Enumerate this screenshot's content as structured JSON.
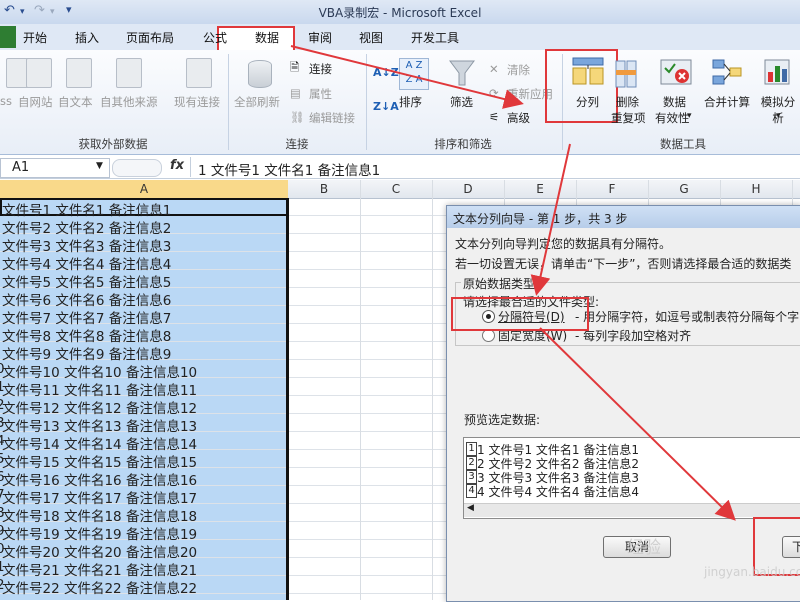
{
  "window": {
    "title": "VBA录制宏 - Microsoft Excel"
  },
  "quick_access": {
    "undo_icon": "undo-icon",
    "redo_icon": "redo-icon",
    "customize": "▾"
  },
  "tabs": [
    "开始",
    "插入",
    "页面布局",
    "公式",
    "数据",
    "审阅",
    "视图",
    "开发工具"
  ],
  "active_tab": "数据",
  "ribbon": {
    "external": {
      "label": "获取外部数据",
      "buttons": [
        "ss",
        "自网站",
        "自文本",
        "自其他来源",
        "现有连接"
      ]
    },
    "connections": {
      "label": "连接",
      "refresh": "全部刷新",
      "items": [
        "连接",
        "属性",
        "编辑链接"
      ]
    },
    "sortfilter": {
      "label": "排序和筛选",
      "sort": "排序",
      "filter": "筛选",
      "items": [
        "清除",
        "重新应用",
        "高级"
      ]
    },
    "datatools": {
      "label": "数据工具",
      "text_to_columns": "分列",
      "remove_dup": [
        "删除",
        "重复项"
      ],
      "validation": [
        "数据",
        "有效性"
      ],
      "consolidate": "合并计算",
      "whatif": "模拟分析"
    }
  },
  "formula_bar": {
    "name_box": "A1",
    "fx": "fx",
    "content": "1  文件号1  文件名1  备注信息1"
  },
  "columns": [
    "A",
    "B",
    "C",
    "D",
    "E",
    "F",
    "G",
    "H"
  ],
  "rows": [
    "文件号1  文件名1  备注信息1",
    "文件号2  文件名2  备注信息2",
    "文件号3  文件名3  备注信息3",
    "文件号4  文件名4  备注信息4",
    "文件号5  文件名5  备注信息5",
    "文件号6  文件名6  备注信息6",
    "文件号7  文件名7  备注信息7",
    "文件号8  文件名8  备注信息8",
    "文件号9  文件名9  备注信息9",
    "  文件号10  文件名10  备注信息10",
    "  文件号11  文件名11  备注信息11",
    "  文件号12  文件名12  备注信息12",
    "  文件号13  文件名13  备注信息13",
    "  文件号14  文件名14  备注信息14",
    "  文件号15  文件名15  备注信息15",
    "  文件号16  文件名16  备注信息16",
    "  文件号17  文件名17  备注信息17",
    "  文件号18  文件名18  备注信息18",
    "  文件号19  文件名19  备注信息19",
    "  文件号20  文件名20  备注信息20",
    "  文件号21  文件名21  备注信息21",
    "  文件号22  文件名22  备注信息22"
  ],
  "row_prefix": [
    "",
    "",
    "",
    "",
    "",
    "",
    "",
    "",
    "",
    "0",
    "1",
    "2",
    "3",
    "4",
    "5",
    "6",
    "7",
    "8",
    "9",
    "0",
    "1",
    "2"
  ],
  "dialog": {
    "title": "文本分列向导 - 第 1 步，共 3 步",
    "line1": "文本分列向导判定您的数据具有分隔符。",
    "line2": "若一切设置无误，请单击“下一步”，否则请选择最合适的数据类",
    "group_label": "原始数据类型",
    "choose_label": "请选择最合适的文件类型:",
    "option_delimited": "分隔符号(D)",
    "option_delimited_desc": "- 用分隔字符，如逗号或制表符分隔每个字",
    "option_fixed": "固定宽度(W)",
    "option_fixed_desc": "- 每列字段加空格对齐",
    "preview_label": "预览选定数据:",
    "preview_rows": [
      "1  文件号1  文件名1  备注信息1",
      "2  文件号2  文件名2  备注信息2",
      "3  文件号3  文件名3  备注信息3",
      "4  文件号4  文件名4  备注信息4"
    ],
    "preview_nums": [
      "1",
      "2",
      "3",
      "4"
    ],
    "cancel": "取消",
    "next": "下"
  },
  "watermark": {
    "line1": "经验",
    "line2": "jingyan.baidu.com"
  },
  "annotation_color": "#e0383b"
}
